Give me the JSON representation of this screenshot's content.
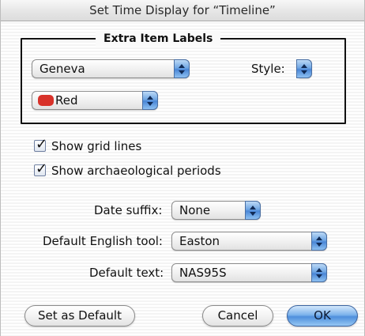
{
  "window": {
    "title": "Set Time Display for “Timeline”"
  },
  "extra_labels": {
    "group_title": "Extra Item Labels",
    "font_value": "Geneva",
    "style_label": "Style:",
    "color_value": "Red",
    "color_hex": "#d8322a"
  },
  "options": {
    "show_grid_lines": {
      "label": "Show grid lines",
      "checked": true
    },
    "show_archaeological_periods": {
      "label": "Show archaeological periods",
      "checked": true
    }
  },
  "fields": {
    "date_suffix": {
      "label": "Date suffix:",
      "value": "None"
    },
    "default_english_tool": {
      "label": "Default English tool:",
      "value": "Easton"
    },
    "default_text": {
      "label": "Default text:",
      "value": "NAS95S"
    }
  },
  "buttons": {
    "set_default": "Set as Default",
    "cancel": "Cancel",
    "ok": "OK"
  }
}
